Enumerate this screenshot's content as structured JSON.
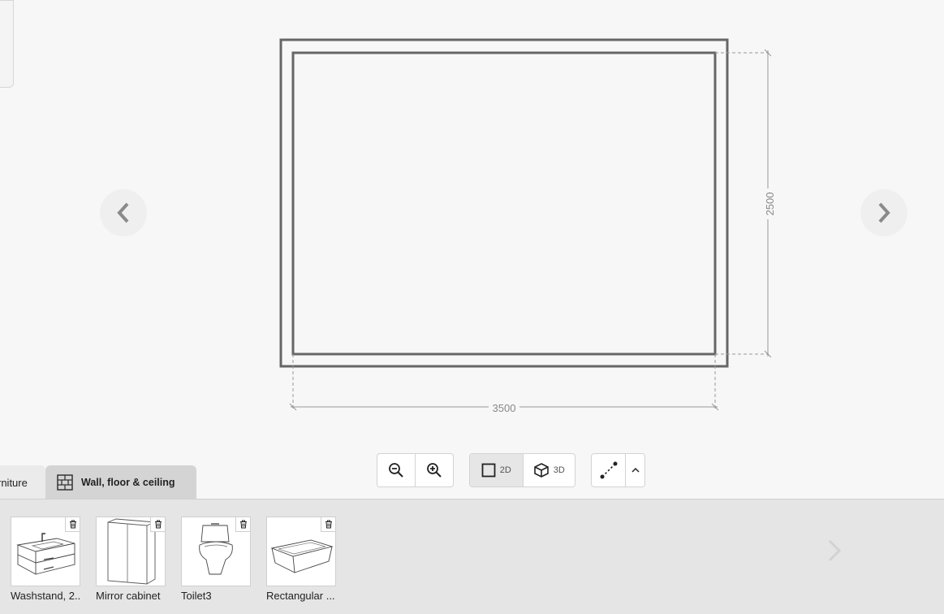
{
  "canvas": {
    "dimension_width": "3500",
    "dimension_height": "2500"
  },
  "toolbar": {
    "zoom_out_icon": "zoom-out-icon",
    "zoom_in_icon": "zoom-in-icon",
    "view_2d_label": "2D",
    "view_3d_label": "3D",
    "active_view": "2D",
    "measure_icon": "measure-line-icon",
    "expand_icon": "chevron-up-icon"
  },
  "tabs": [
    {
      "label": "rniture"
    },
    {
      "label": "Wall, floor & ceiling",
      "active": true
    }
  ],
  "tray": {
    "items": [
      {
        "label": "Washstand, 2...",
        "icon": "washstand-thumbnail"
      },
      {
        "label": "Mirror cabinet",
        "icon": "mirror-cabinet-thumbnail"
      },
      {
        "label": "Toilet3",
        "icon": "toilet-thumbnail"
      },
      {
        "label": "Rectangular ...",
        "icon": "bathtub-thumbnail"
      }
    ]
  },
  "colors": {
    "wall": "#666666",
    "dimension": "#999999",
    "background": "#f7f7f7",
    "tray": "#e5e5e5"
  }
}
